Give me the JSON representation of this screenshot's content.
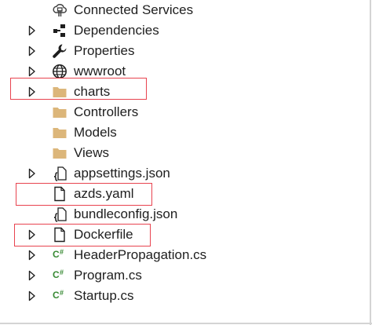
{
  "tree": {
    "items": [
      {
        "label": "Connected Services",
        "icon": "connected-services-icon",
        "expandable": false
      },
      {
        "label": "Dependencies",
        "icon": "dependencies-icon",
        "expandable": true
      },
      {
        "label": "Properties",
        "icon": "wrench-icon",
        "expandable": true
      },
      {
        "label": "wwwroot",
        "icon": "globe-icon",
        "expandable": true
      },
      {
        "label": "charts",
        "icon": "folder-icon",
        "expandable": true
      },
      {
        "label": "Controllers",
        "icon": "folder-icon",
        "expandable": false
      },
      {
        "label": "Models",
        "icon": "folder-icon",
        "expandable": false
      },
      {
        "label": "Views",
        "icon": "folder-icon",
        "expandable": false
      },
      {
        "label": "appsettings.json",
        "icon": "json-file-icon",
        "expandable": true
      },
      {
        "label": "azds.yaml",
        "icon": "file-icon",
        "expandable": false
      },
      {
        "label": "bundleconfig.json",
        "icon": "json-file-icon",
        "expandable": false
      },
      {
        "label": "Dockerfile",
        "icon": "file-icon",
        "expandable": true
      },
      {
        "label": "HeaderPropagation.cs",
        "icon": "csharp-file-icon",
        "expandable": true
      },
      {
        "label": "Program.cs",
        "icon": "csharp-file-icon",
        "expandable": true
      },
      {
        "label": "Startup.cs",
        "icon": "csharp-file-icon",
        "expandable": true
      }
    ]
  },
  "highlights": [
    "charts",
    "azds.yaml",
    "Dockerfile"
  ],
  "colors": {
    "highlight_border": "#e8434f",
    "folder": "#dcb67a",
    "csharp": "#388a34",
    "text": "#1e1e1e",
    "icon_dark": "#424242"
  }
}
